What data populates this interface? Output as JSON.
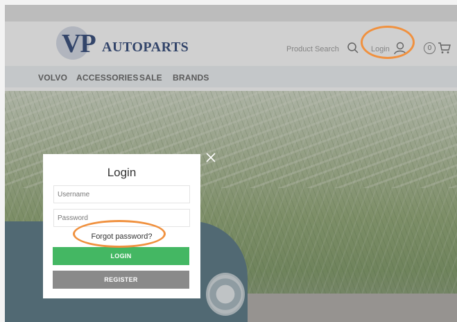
{
  "header": {
    "logo_vp": "VP",
    "logo_rest": "AUTOPARTS",
    "product_search": "Product Search",
    "login_label": "Login",
    "cart_count": "0"
  },
  "nav": {
    "items": [
      {
        "label": "VOLVO"
      },
      {
        "label": "ACCESSORIES"
      },
      {
        "label": "SALE"
      },
      {
        "label": "BRANDS"
      }
    ]
  },
  "modal": {
    "title": "Login",
    "username_placeholder": "Username",
    "password_placeholder": "Password",
    "forgot_label": "Forgot password?",
    "login_button": "LOGIN",
    "register_button": "REGISTER",
    "close_symbol": "×"
  },
  "colors": {
    "brand": "#0f2a63",
    "login_button": "#44b763",
    "register_button": "#8a8a8a",
    "highlight": "#f0913f"
  },
  "icons": [
    "search-icon",
    "user-icon",
    "cart-icon",
    "close-icon"
  ]
}
